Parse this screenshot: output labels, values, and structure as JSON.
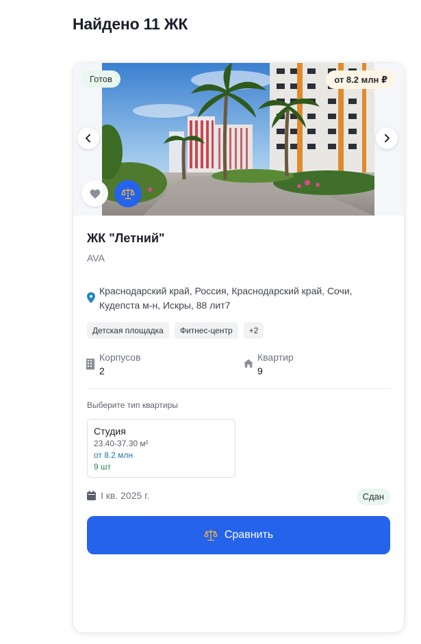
{
  "page": {
    "heading": "Найдено 11 ЖК"
  },
  "card": {
    "status_badge": "Готов",
    "price_badge": "от 8.2 млн ₽",
    "title": "ЖК \"Летний\"",
    "developer": "AVA",
    "address": "Краснодарский край, Россия, Краснодарский край, Сочи, Кудепста м-н, Искры, 88 лит7",
    "tags": [
      "Детская площадка",
      "Фитнес-центр",
      "+2"
    ],
    "stats": {
      "buildings_label": "Корпусов",
      "buildings_value": "2",
      "apartments_label": "Квартир",
      "apartments_value": "9"
    },
    "apartment_types": {
      "title": "Выберите тип квартиры",
      "items": [
        {
          "name": "Студия",
          "area": "23.40-37.30 м²",
          "price": "от 8.2 млн",
          "count": "9 шт"
        }
      ]
    },
    "deadline": "I кв. 2025 г.",
    "construction_status": "Сдан",
    "compare_label": "Сравнить"
  },
  "colors": {
    "accent": "#2563eb",
    "ready_badge_bg": "#e9f7ee",
    "price_badge_bg": "#fff5e6"
  },
  "icons": [
    "chevron-left-icon",
    "chevron-right-icon",
    "heart-icon",
    "scales-icon",
    "location-pin-icon",
    "building-icon",
    "house-icon",
    "calendar-icon"
  ]
}
